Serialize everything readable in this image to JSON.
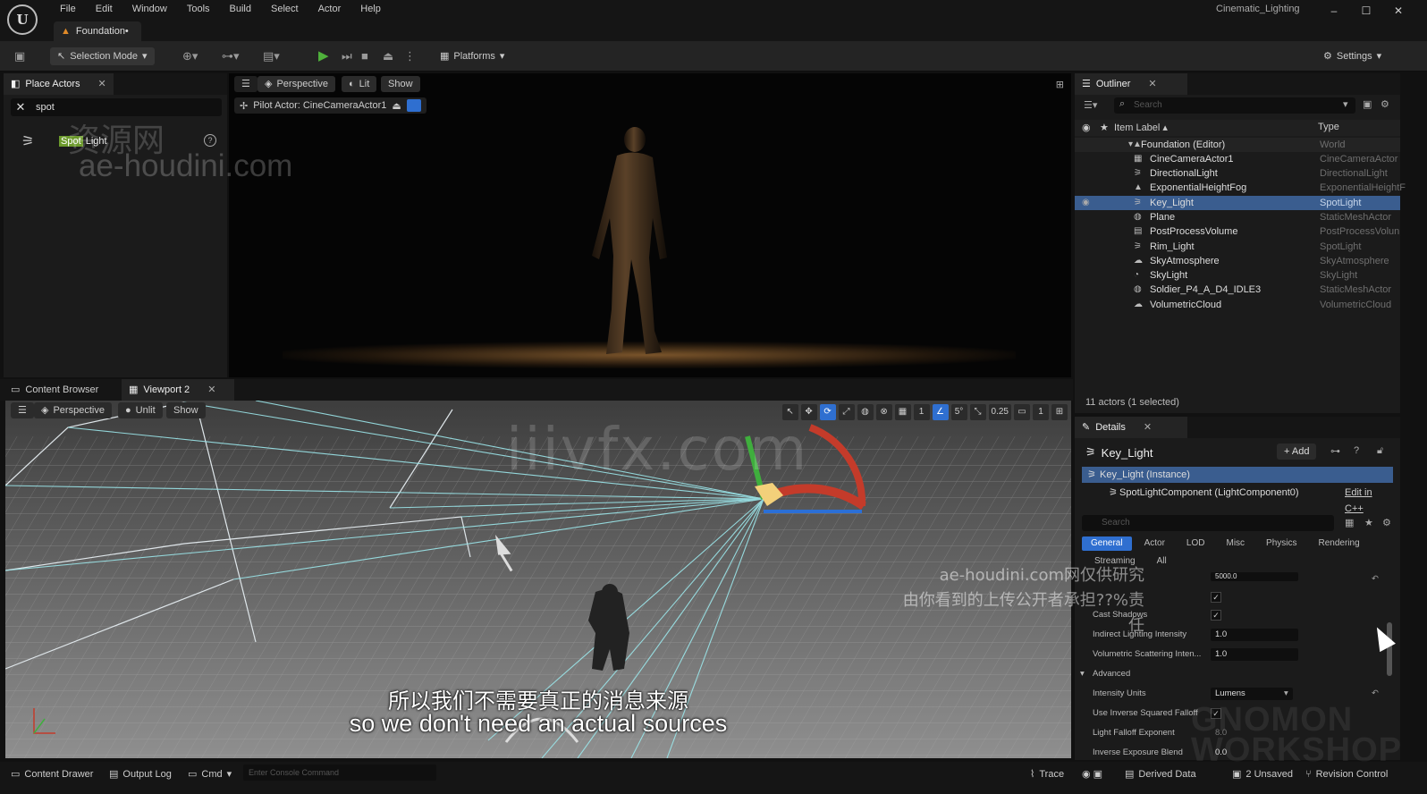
{
  "app": {
    "logo_glyph": "U",
    "menu": [
      "File",
      "Edit",
      "Window",
      "Tools",
      "Build",
      "Select",
      "Actor",
      "Help"
    ],
    "doc_tab": "Foundation•",
    "window_title": "Cinematic_Lighting",
    "win_controls": [
      "–",
      "☐",
      "✕"
    ]
  },
  "toolbar": {
    "selection_mode": "Selection Mode",
    "platforms": "Platforms",
    "settings": "Settings"
  },
  "place_actors": {
    "tab": "Place Actors",
    "search_value": "spot",
    "result_highlight": "Spot",
    "result_rest": " Light",
    "help_glyph": "?"
  },
  "viewport1": {
    "perspective": "Perspective",
    "lit": "Lit",
    "show": "Show",
    "pilot_actor": "Pilot Actor: CineCameraActor1"
  },
  "midtabs": {
    "content_browser": "Content Browser",
    "viewport2": "Viewport 2"
  },
  "viewport2": {
    "perspective": "Perspective",
    "unlit": "Unlit",
    "show": "Show",
    "grid_val": "1",
    "angle_val": "5°",
    "scale_val": "0.25",
    "cam_speed": "1"
  },
  "subtitle": {
    "cn": "所以我们不需要真正的消息来源",
    "en": "so we don't need an actual sources"
  },
  "outliner": {
    "tab": "Outliner",
    "search_placeholder": "Search",
    "col_label": "Item Label ▴",
    "col_type": "Type",
    "root": {
      "label": "Foundation (Editor)",
      "type": "World"
    },
    "items": [
      {
        "label": "CineCameraActor1",
        "type": "CineCameraActor"
      },
      {
        "label": "DirectionalLight",
        "type": "DirectionalLight"
      },
      {
        "label": "ExponentialHeightFog",
        "type": "ExponentialHeightF"
      },
      {
        "label": "Key_Light",
        "type": "SpotLight"
      },
      {
        "label": "Plane",
        "type": "StaticMeshActor"
      },
      {
        "label": "PostProcessVolume",
        "type": "PostProcessVolun"
      },
      {
        "label": "Rim_Light",
        "type": "SpotLight"
      },
      {
        "label": "SkyAtmosphere",
        "type": "SkyAtmosphere"
      },
      {
        "label": "SkyLight",
        "type": "SkyLight"
      },
      {
        "label": "Soldier_P4_A_D4_IDLE3",
        "type": "StaticMeshActor"
      },
      {
        "label": "VolumetricCloud",
        "type": "VolumetricCloud"
      }
    ],
    "footer": "11 actors (1 selected)"
  },
  "details": {
    "tab": "Details",
    "actor_name": "Key_Light",
    "add_label": "Add",
    "instance_label": "Key_Light (Instance)",
    "component_label": "SpotLightComponent (LightComponent0)",
    "edit_link": "Edit in C++",
    "search_placeholder": "Search",
    "categories": [
      "General",
      "Actor",
      "LOD",
      "Misc",
      "Physics",
      "Rendering"
    ],
    "categories2": [
      "Streaming",
      "All"
    ],
    "props": [
      {
        "name": "Cast Shadows",
        "kind": "check",
        "value": "✓"
      },
      {
        "name": "Indirect Lighting Intensity",
        "kind": "value",
        "value": "1.0"
      },
      {
        "name": "Volumetric Scattering Inten...",
        "kind": "value",
        "value": "1.0"
      },
      {
        "name": "Intensity Units",
        "kind": "select",
        "value": "Lumens"
      },
      {
        "name": "Use Inverse Squared Falloff",
        "kind": "check",
        "value": "✓"
      },
      {
        "name": "Light Falloff Exponent",
        "kind": "value",
        "value": "8.0"
      },
      {
        "name": "Inverse Exposure Blend",
        "kind": "value",
        "value": "0.0"
      }
    ],
    "top_value": "5000.0",
    "advanced_label": "Advanced"
  },
  "statusbar": {
    "content_drawer": "Content Drawer",
    "output_log": "Output Log",
    "cmd": "Cmd",
    "console_placeholder": "Enter Console Command",
    "trace": "Trace",
    "derived_data": "Derived Data",
    "unsaved": "2 Unsaved",
    "revision": "Revision Control"
  },
  "watermarks": {
    "zy": "资源网",
    "ae": "ae-houdini.com",
    "iiv": "iiivfx.com",
    "notice1": "ae-houdini.com网仅供研究",
    "notice2": "由你看到的上传公开者承担??%责任",
    "gnomon1": "GNOMON",
    "gnomon2": "WORKSHOP"
  },
  "colors": {
    "accent_blue": "#2f6fd0",
    "selection": "#3a5d8f",
    "play_green": "#4fb13b"
  }
}
